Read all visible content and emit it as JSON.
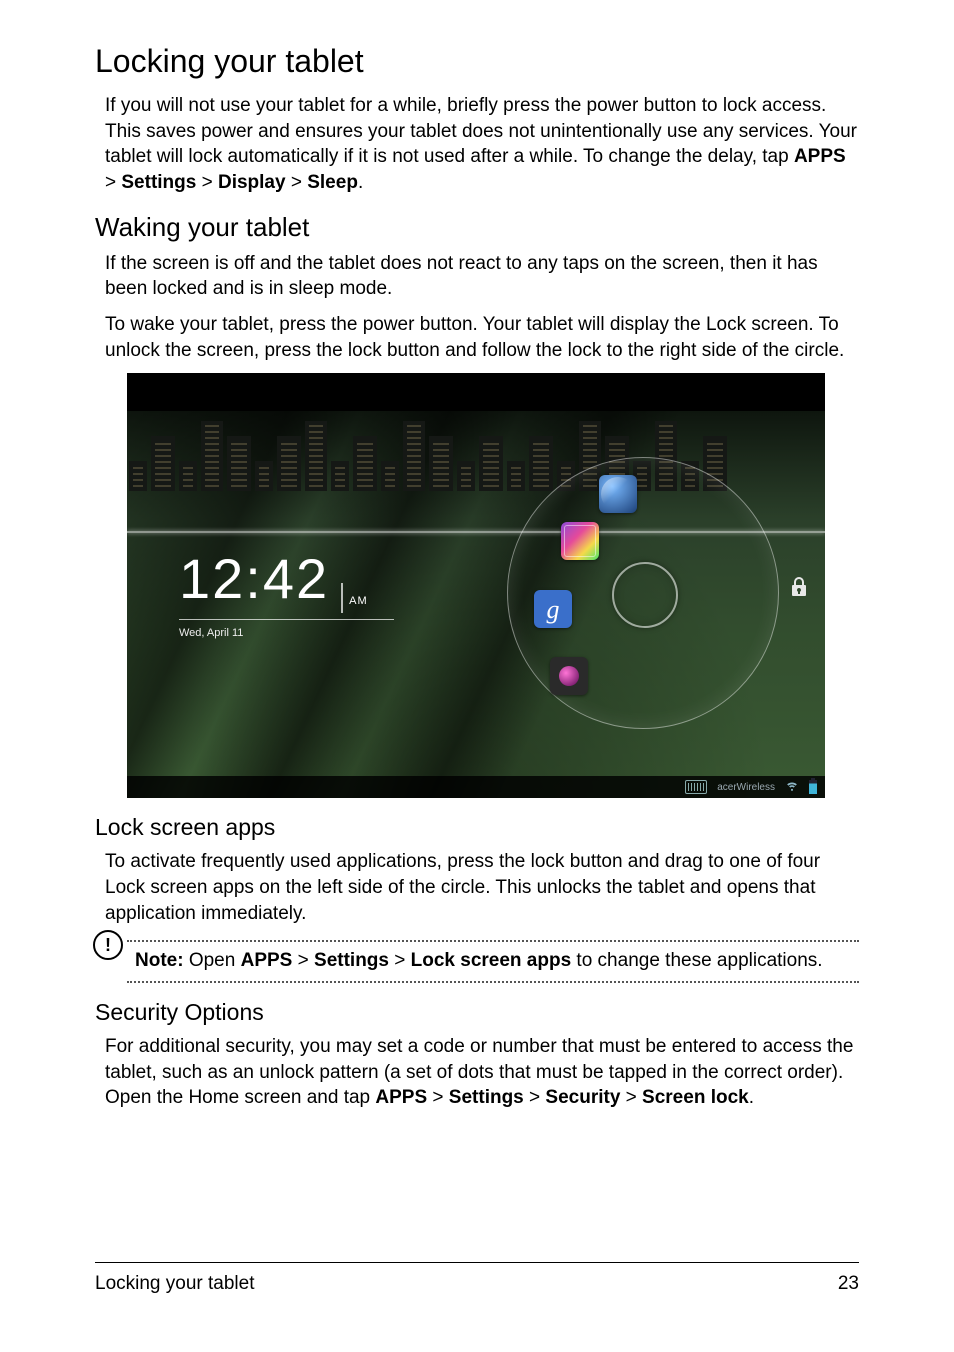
{
  "h1": "Locking your tablet",
  "p1a": "If you will not use your tablet for a while, briefly press the power button to lock access. This saves power and ensures your tablet does not unintentionally use any services. Your tablet will lock automatically if it is not used after a while. To change the delay, tap ",
  "p1_path": {
    "apps": "APPS",
    "sep": " > ",
    "settings": "Settings",
    "display": "Display",
    "sleep": "Sleep",
    "end": "."
  },
  "h2_waking": "Waking your tablet",
  "p2": "If the screen is off and the tablet does not react to any taps on the screen, then it has been locked and is in sleep mode.",
  "p3": "To wake your tablet, press the power button. Your tablet will display the Lock screen. To unlock the screen, press the lock button and follow the lock to the right side of the circle.",
  "lockscreen": {
    "time": "12:42",
    "ampm": "AM",
    "date": "Wed, April 11",
    "google_label": "g",
    "wifi_label": "acerWireless"
  },
  "h3_apps": "Lock screen apps",
  "p4": "To activate frequently used applications, press the lock button and drag to one of four Lock screen apps on the left side of the circle. This unlocks the tablet and opens that application immediately.",
  "note": {
    "label": "Note:",
    "pre": " Open ",
    "apps": "APPS",
    "sep": " > ",
    "settings": "Settings",
    "lockapps": "Lock screen apps",
    "post": " to change these applications."
  },
  "h3_security": "Security Options",
  "p5a": "For additional security, you may set a code or number that must be entered to access the tablet, such as an unlock pattern (a set of dots that must be tapped in the correct order). Open the Home screen and tap ",
  "p5_path": {
    "apps": "APPS",
    "sep": " > ",
    "settings": "Settings",
    "security": "Security",
    "screenlock": "Screen lock",
    "end": "."
  },
  "footer": {
    "title": "Locking your tablet",
    "page": "23"
  }
}
